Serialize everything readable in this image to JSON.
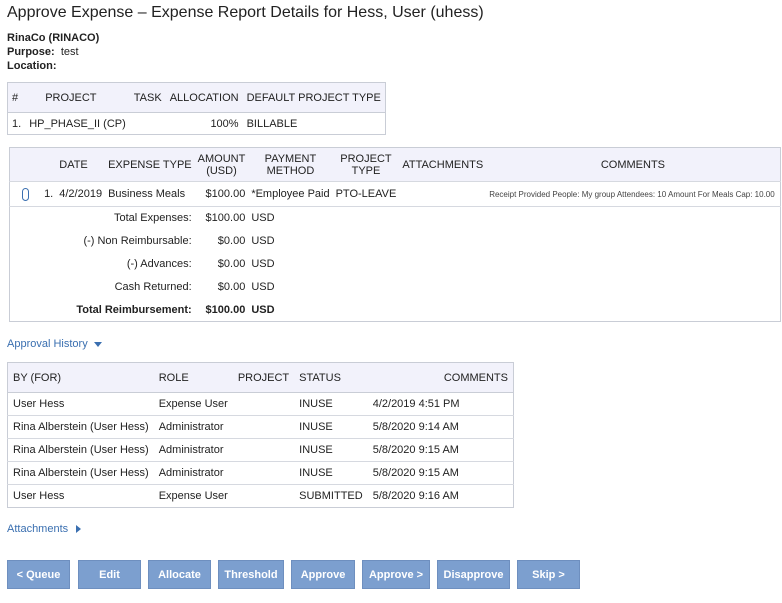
{
  "page": {
    "title": "Approve Expense – Expense Report Details for Hess, User (uhess)"
  },
  "report": {
    "company": "RinaCo (RINACO)",
    "purpose_label": "Purpose:",
    "purpose_value": "test",
    "location_label": "Location:",
    "location_value": ""
  },
  "project_table": {
    "headers": [
      "#",
      "PROJECT",
      "TASK",
      "ALLOCATION",
      "DEFAULT PROJECT TYPE"
    ],
    "rows": [
      {
        "num": "1.",
        "project": "HP_PHASE_II (CP)",
        "task": "",
        "allocation": "100%",
        "type": "BILLABLE"
      }
    ]
  },
  "expense_table": {
    "headers": {
      "date": "DATE",
      "expense_type": "EXPENSE TYPE",
      "amount_l1": "AMOUNT",
      "amount_l2": "(USD)",
      "payment_l1": "PAYMENT",
      "payment_l2": "METHOD",
      "project_l1": "PROJECT",
      "project_l2": "TYPE",
      "attachments": "ATTACHMENTS",
      "comments": "COMMENTS"
    },
    "rows": [
      {
        "num": "1.",
        "date": "4/2/2019",
        "expense_type": "Business Meals",
        "amount": "$100.00",
        "payment": "*Employee Paid",
        "project_type": "PTO-LEAVE",
        "attachments": "",
        "comments": "Receipt Provided People: My group Attendees: 10 Amount For Meals Cap: 10.00"
      }
    ],
    "summary": [
      {
        "label": "Total Expenses:",
        "value": "$100.00",
        "currency": "USD"
      },
      {
        "label": "(-) Non Reimbursable:",
        "value": "$0.00",
        "currency": "USD"
      },
      {
        "label": "(-) Advances:",
        "value": "$0.00",
        "currency": "USD"
      },
      {
        "label": "Cash Returned:",
        "value": "$0.00",
        "currency": "USD"
      },
      {
        "label": "Total Reimbursement:",
        "value": "$100.00",
        "currency": "USD"
      }
    ]
  },
  "approval_history": {
    "link_label": "Approval History",
    "headers": [
      "BY (FOR)",
      "ROLE",
      "PROJECT",
      "STATUS",
      "COMMENTS"
    ],
    "rows": [
      {
        "by": "User Hess",
        "role": "Expense User",
        "project": "",
        "status": "INUSE",
        "comments": "4/2/2019 4:51 PM"
      },
      {
        "by": "Rina Alberstein (User Hess)",
        "role": "Administrator",
        "project": "",
        "status": "INUSE",
        "comments": "5/8/2020 9:14 AM"
      },
      {
        "by": "Rina Alberstein (User Hess)",
        "role": "Administrator",
        "project": "",
        "status": "INUSE",
        "comments": "5/8/2020 9:15 AM"
      },
      {
        "by": "Rina Alberstein (User Hess)",
        "role": "Administrator",
        "project": "",
        "status": "INUSE",
        "comments": "5/8/2020 9:15 AM"
      },
      {
        "by": "User Hess",
        "role": "Expense User",
        "project": "",
        "status": "SUBMITTED",
        "comments": "5/8/2020 9:16 AM"
      }
    ]
  },
  "attachments_link": "Attachments",
  "buttons": [
    "< Queue",
    "Edit",
    "Allocate",
    "Threshold",
    "Approve",
    "Approve >",
    "Disapprove",
    "Skip >"
  ],
  "colors": {
    "button_bg": "#7c9fcf",
    "link": "#3a6fb0",
    "header_bg": "#f2f2fb"
  }
}
